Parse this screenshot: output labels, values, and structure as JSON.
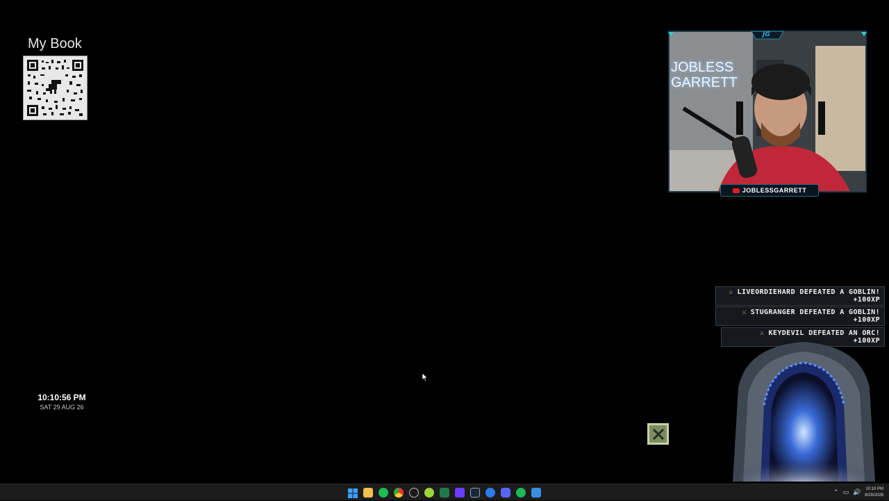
{
  "book_widget": {
    "title": "My Book"
  },
  "clock": {
    "time": "10:10:56 PM",
    "date": "SAT 29 AUG 26"
  },
  "webcam": {
    "logo_text": "JG",
    "channel_name": "JOBLESSGARRETT",
    "wall_sign": [
      "JOBLESS",
      "GARRETT"
    ]
  },
  "alerts": [
    {
      "line1": "LIVEORDIEHARD DEFEATED A GOBLIN!",
      "line2": "+100XP"
    },
    {
      "line1": "STUGRANGER DEFEATED A GOBLIN!",
      "line2": "+100XP"
    },
    {
      "line1": "KEYDEVIL DEFEATED AN ORC! +100XP",
      "line2": ""
    }
  ],
  "taskbar": {
    "icons": [
      "windows-start-icon",
      "file-explorer-icon",
      "spotify-icon",
      "chrome-icon",
      "settings-icon",
      "app-green-icon",
      "excel-icon",
      "app-purple-icon",
      "steam-icon",
      "app-blue-icon",
      "discord-icon",
      "spotify-icon-2",
      "app-blue-2-icon"
    ],
    "tray_time": "10:10 PM",
    "tray_date": "8/29/2026"
  },
  "colors": {
    "accent": "#2a8ab0",
    "alert_bg": "#15191d",
    "portal_glow": "#3a6bd8"
  }
}
